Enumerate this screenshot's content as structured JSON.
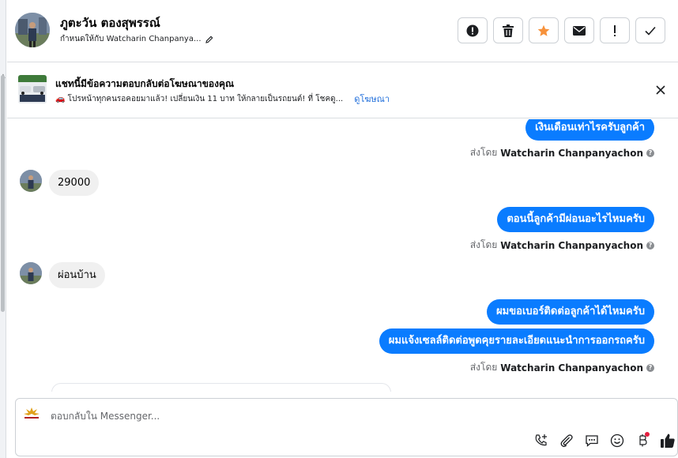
{
  "header": {
    "contact_name": "ภูตะวัน ตองสุพรรณ์",
    "assigned_to": "กำหนดให้กับ Watcharin Chanpanya...",
    "actions": [
      {
        "icon": "alert-circle-icon",
        "name": "spam-button"
      },
      {
        "icon": "trash-icon",
        "name": "delete-button"
      },
      {
        "icon": "star-icon",
        "name": "star-button"
      },
      {
        "icon": "envelope-icon",
        "name": "mark-unread-button"
      },
      {
        "icon": "exclamation-icon",
        "name": "follow-up-button"
      },
      {
        "icon": "checkmark-icon",
        "name": "mark-done-button"
      }
    ]
  },
  "ad_banner": {
    "title": "แชทนี้มีข้อความตอบกลับต่อโฆษณาของคุณ",
    "description": "🚗 โปรหน้าทุกคนรอคอยมาแล้ว! เปลี่ยนเงิน 11 บาท ให้กลายเป็นรถยนต์! ที่ โชคดู...",
    "link": "ดูโฆษณา"
  },
  "messages": [
    {
      "direction": "out",
      "text": "เงินเดือนเท่าไรครับลูกค้า"
    },
    {
      "type": "sender",
      "prefix": "ส่งโดย",
      "name": "Watcharin Chanpanyachon"
    },
    {
      "direction": "in",
      "text": "29000"
    },
    {
      "direction": "out",
      "text": "ตอนนี้ลูกค้ามีผ่อนอะไรไหมครับ"
    },
    {
      "type": "sender",
      "prefix": "ส่งโดย",
      "name": "Watcharin Chanpanyachon"
    },
    {
      "direction": "in",
      "text": "ผ่อนบ้าน"
    },
    {
      "direction": "out",
      "text": "ผมขอเบอร์ติดต่อลูกค้าได้ไหมครับ"
    },
    {
      "direction": "out",
      "text": "ผมแจ้งเซลล์ติดต่อพูดคุยรายละเอียดแนะนำการออกรถครับ"
    },
    {
      "type": "sender",
      "prefix": "ส่งโดย",
      "name": "Watcharin Chanpanyachon"
    }
  ],
  "composer": {
    "placeholder": "ตอบกลับใน Messenger...",
    "tools": [
      "add-contact-icon",
      "attachment-icon",
      "saved-replies-icon",
      "emoji-icon",
      "currency-icon",
      "thumbs-up-icon"
    ]
  },
  "colors": {
    "outgoing_bubble": "#0a7cff",
    "incoming_bubble": "#f0f0f0",
    "star": "#f7923b",
    "link": "#216fdb"
  }
}
